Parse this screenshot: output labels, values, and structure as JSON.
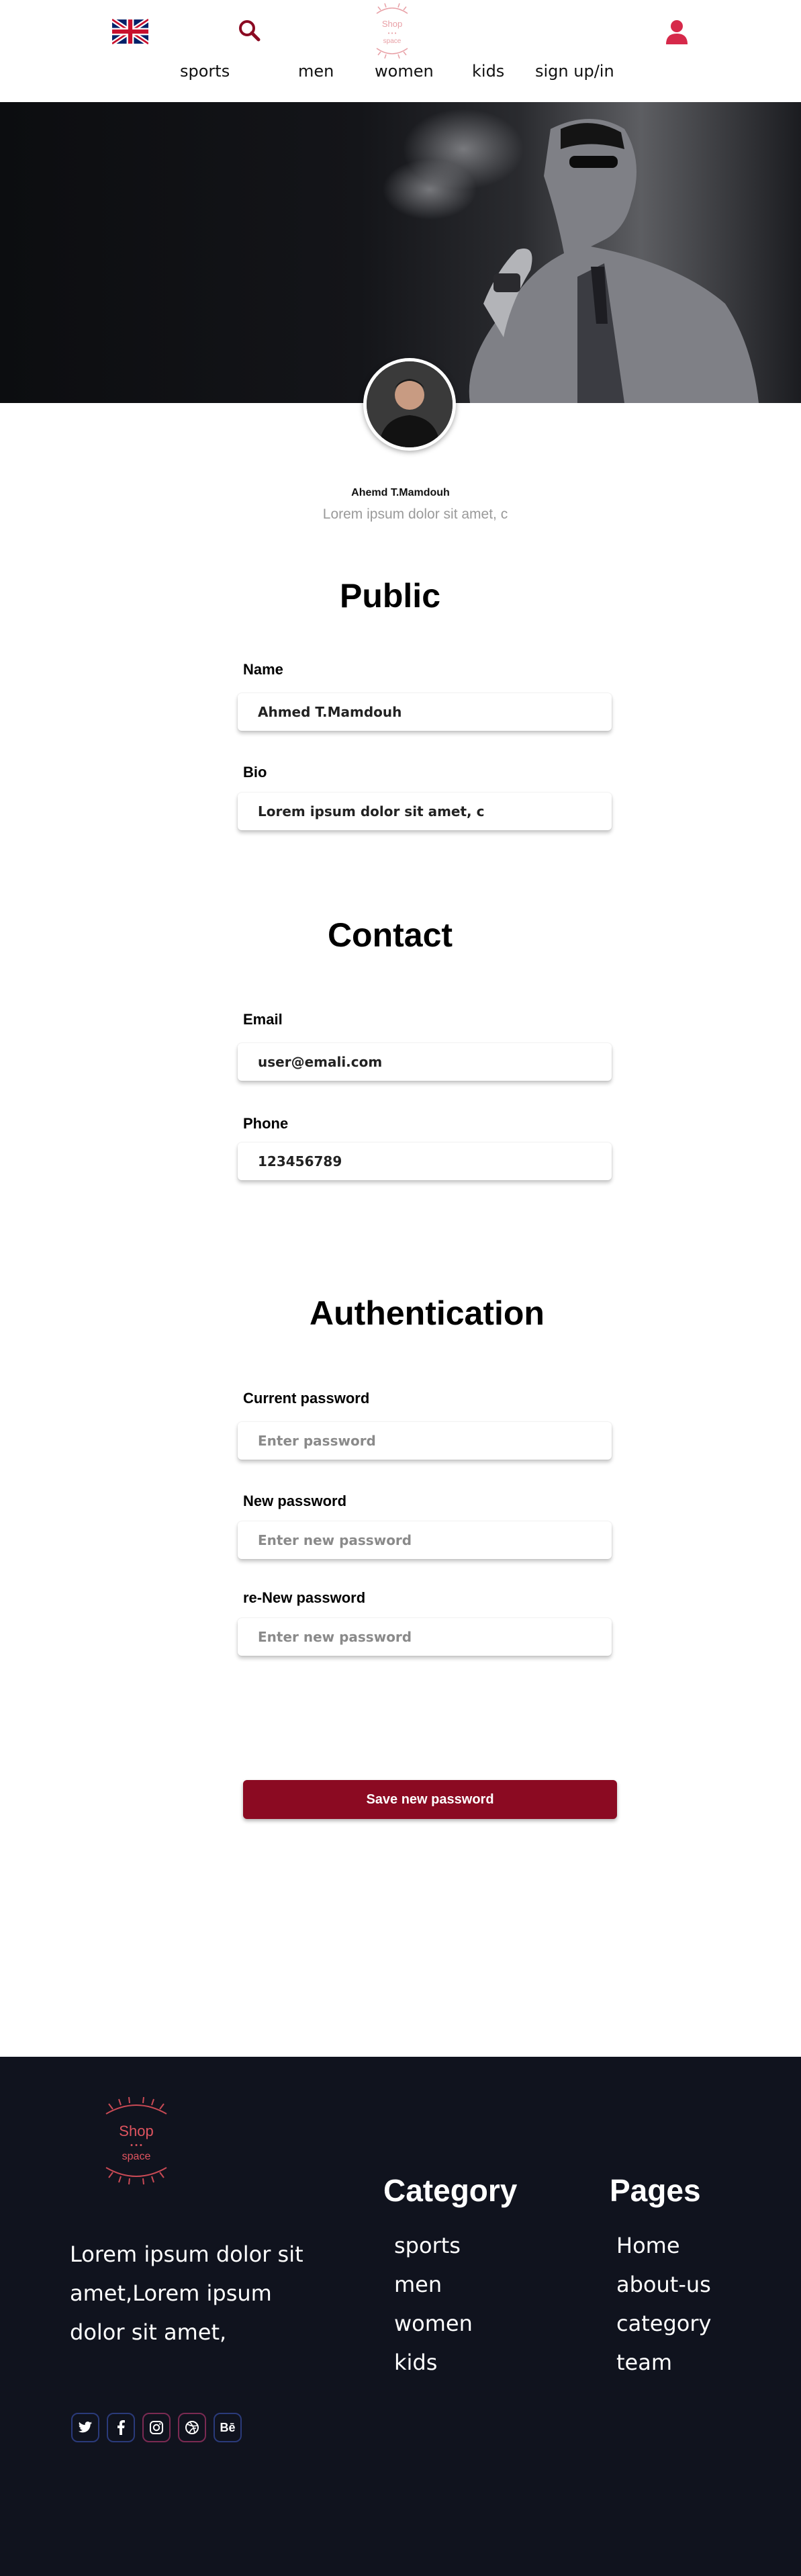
{
  "header": {
    "nav": [
      "sports",
      "men",
      "women",
      "kids",
      "sign up/in"
    ],
    "logo_text": [
      "Shop",
      "space"
    ]
  },
  "profile": {
    "name": "Ahemd T.Mamdouh",
    "bio": "Lorem ipsum dolor sit amet, c"
  },
  "public": {
    "title": "Public",
    "name_label": "Name",
    "name_value": "Ahmed T.Mamdouh",
    "bio_label": "Bio",
    "bio_value": "Lorem ipsum dolor sit amet, c"
  },
  "contact": {
    "title": "Contact",
    "email_label": "Email",
    "email_value": "user@emali.com",
    "phone_label": "Phone",
    "phone_value": "123456789"
  },
  "auth": {
    "title": "Authentication",
    "current_label": "Current password",
    "current_placeholder": "Enter password",
    "new_label": "New password",
    "new_placeholder": "Enter new password",
    "renew_label": "re-New password",
    "renew_placeholder": "Enter new password",
    "save_label": "Save new password"
  },
  "footer": {
    "logo_text": [
      "Shop",
      "space"
    ],
    "about": "Lorem ipsum dolor sit amet,Lorem ipsum dolor sit amet,",
    "category_title": "Category",
    "categories": [
      "sports",
      "men",
      "women",
      "kids"
    ],
    "pages_title": "Pages",
    "pages": [
      "Home",
      "about-us",
      "category",
      "team"
    ],
    "social": [
      "twitter-icon",
      "facebook-icon",
      "instagram-icon",
      "dribbble-icon",
      "behance-icon"
    ],
    "behance_text": "Bē"
  },
  "colors": {
    "accent": "#8b0a22",
    "logo": "#e0545f",
    "footer_bg": "#10131e",
    "user_icon": "#d6294a"
  }
}
